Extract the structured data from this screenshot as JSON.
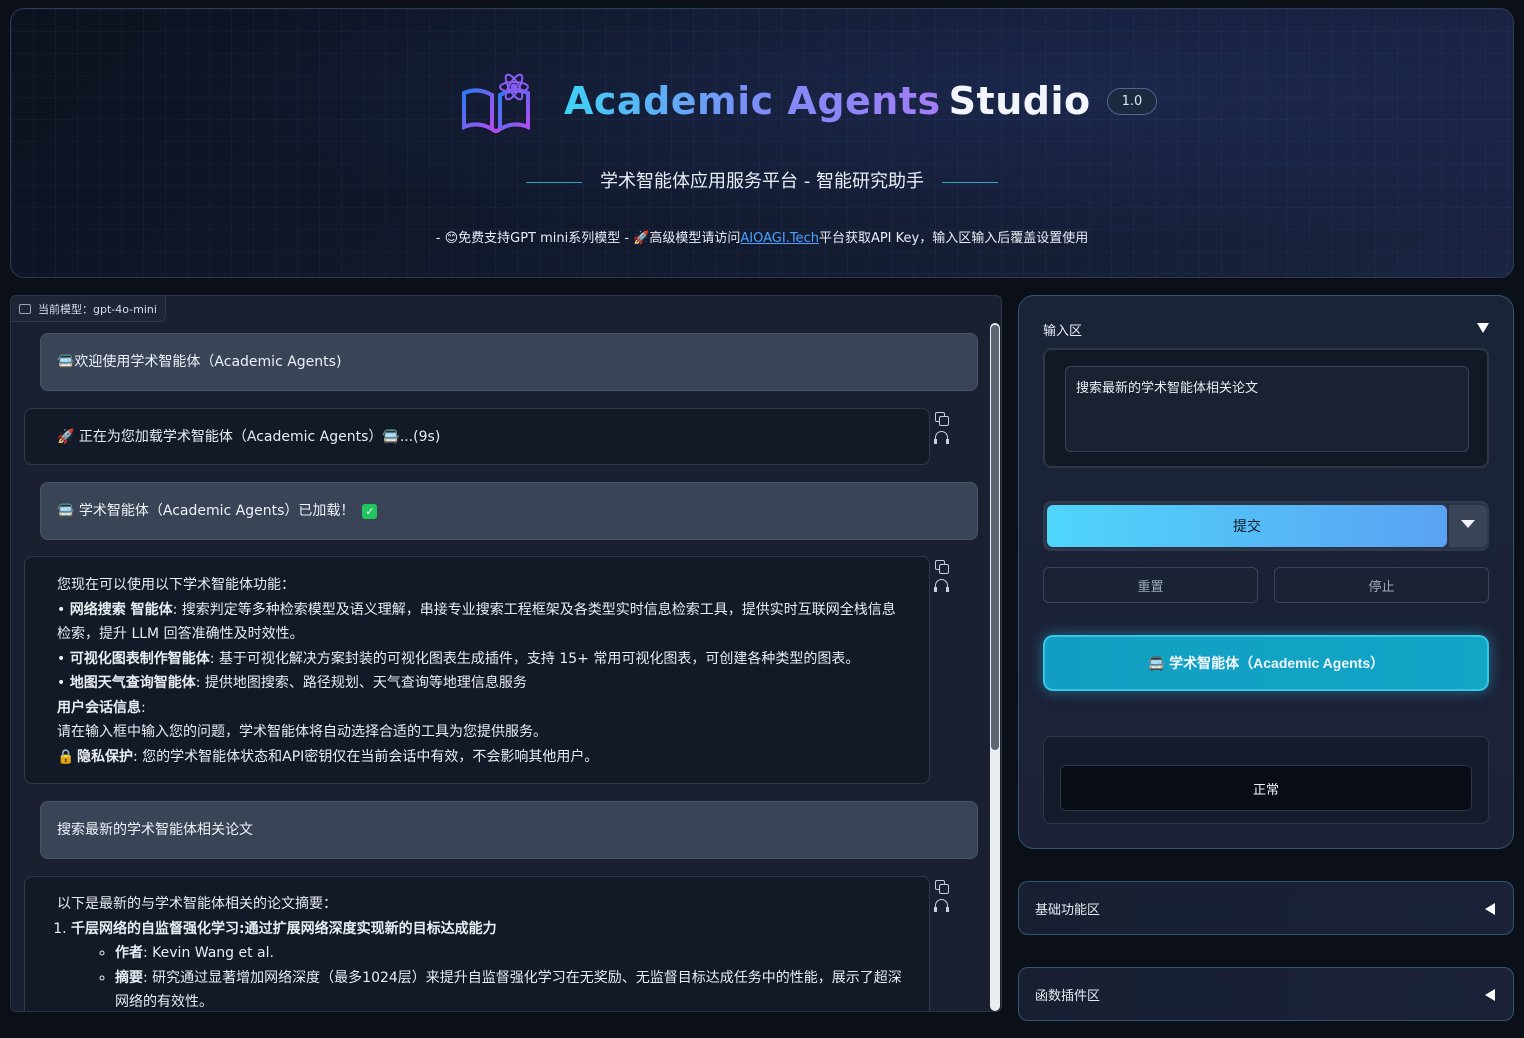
{
  "header": {
    "title_gradient": "Academic Agents",
    "title_plain": "Studio",
    "version": "1.0",
    "subtitle": "学术智能体应用服务平台 - 智能研究助手",
    "notice_prefix": "- 😊免费支持GPT mini系列模型 - 🚀高级模型请访问",
    "notice_link": "AIOAGI.Tech",
    "notice_suffix": "平台获取API Key，输入区输入后覆盖设置使用",
    "logo_icon": "book-atom-icon"
  },
  "chat": {
    "model_tag": "当前模型：gpt-4o-mini",
    "messages": {
      "m1": "🚍欢迎使用学术智能体（Academic Agents)",
      "m2": "🚀 正在为您加载学术智能体（Academic Agents）🚍...(9s)",
      "m3": "🚍 学术智能体（Academic Agents）已加载！",
      "m4": {
        "intro": "您现在可以使用以下学术智能体功能：",
        "f1_title": "网络搜索 智能体",
        "f1_text": ": 搜索判定等多种检索模型及语义理解，串接专业搜索工程框架及各类型实时信息检索工具，提供实时互联网全栈信息检索，提升 LLM 回答准确性及时效性。",
        "f2_title": "可视化图表制作智能体",
        "f2_text": ": 基于可视化解决方案封装的可视化图表生成插件，支持 15+ 常用可视化图表，可创建各种类型的图表。",
        "f3_title": "地图天气查询智能体",
        "f3_text": ": 提供地图搜索、路径规划、天气查询等地理信息服务",
        "session_title": "用户会话信息",
        "session_colon": ":",
        "session_text": "请在输入框中输入您的问题，学术智能体将自动选择合适的工具为您提供服务。",
        "privacy_title": "隐私保护",
        "privacy_text": ": 您的学术智能体状态和API密钥仅在当前会话中有效，不会影响其他用户。"
      },
      "m5": "搜索最新的学术智能体相关论文",
      "m6": {
        "intro": "以下是最新的与学术智能体相关的论文摘要：",
        "item1_title": "千层网络的自监督强化学习:通过扩展网络深度实现新的目标达成能力",
        "author_label": "作者",
        "author_value": ": Kevin Wang et al.",
        "abstract_label": "摘要",
        "abstract_value": ": 研究通过显著增加网络深度（最多1024层）来提升自监督强化学习在无奖励、无监督目标达成任务中的性能，展示了超深网络的有效性。"
      }
    }
  },
  "side": {
    "input_section": "输入区",
    "input_value": "搜索最新的学术智能体相关论文",
    "submit": "提交",
    "reset": "重置",
    "stop": "停止",
    "agent_button": "🚍 学术智能体（Academic Agents）",
    "status": "正常"
  },
  "sections": {
    "basic": "基础功能区",
    "plugins": "函数插件区"
  },
  "colors": {
    "accent_cyan": "#32c7e8",
    "submit_gradient_start": "#4fd6fb",
    "submit_gradient_end": "#5aa2f2",
    "check_green": "#22c55e",
    "link_blue": "#4ea2ff"
  }
}
